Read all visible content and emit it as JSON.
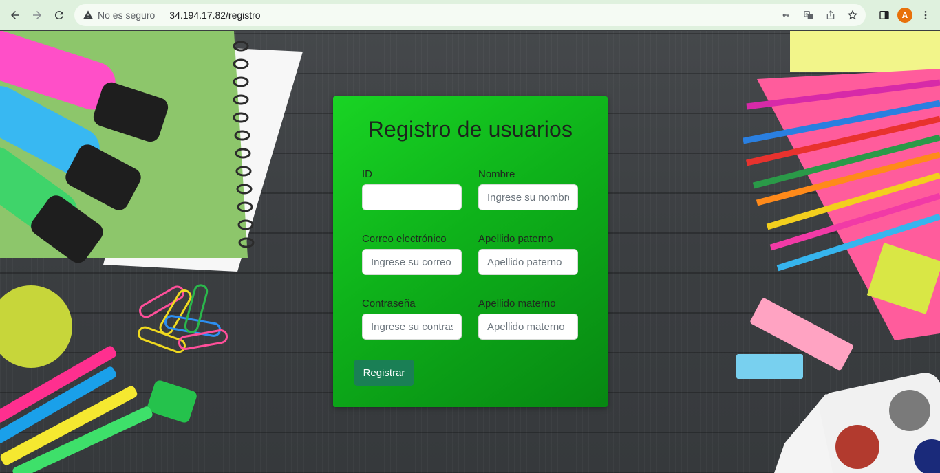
{
  "browser": {
    "security_label": "No es seguro",
    "url": "34.194.17.82/registro",
    "avatar_letter": "A"
  },
  "form": {
    "title": "Registro de usuarios",
    "fields": {
      "id": {
        "label": "ID",
        "placeholder": "",
        "value": ""
      },
      "nombre": {
        "label": "Nombre",
        "placeholder": "Ingrese su nombre",
        "value": ""
      },
      "correo": {
        "label": "Correo electrónico",
        "placeholder": "Ingrese su correo",
        "value": ""
      },
      "apellido_paterno": {
        "label": "Apellido paterno",
        "placeholder": "Apellido paterno",
        "value": ""
      },
      "contrasena": {
        "label": "Contraseña",
        "placeholder": "Ingrese su contraseña",
        "value": ""
      },
      "apellido_materno": {
        "label": "Apellido materno",
        "placeholder": "Apellido materno",
        "value": ""
      }
    },
    "submit_label": "Registrar"
  },
  "colors": {
    "card_start": "#19d424",
    "card_end": "#078712",
    "button": "#1a7f55",
    "chrome": "#dff1de",
    "avatar": "#e8710a"
  }
}
